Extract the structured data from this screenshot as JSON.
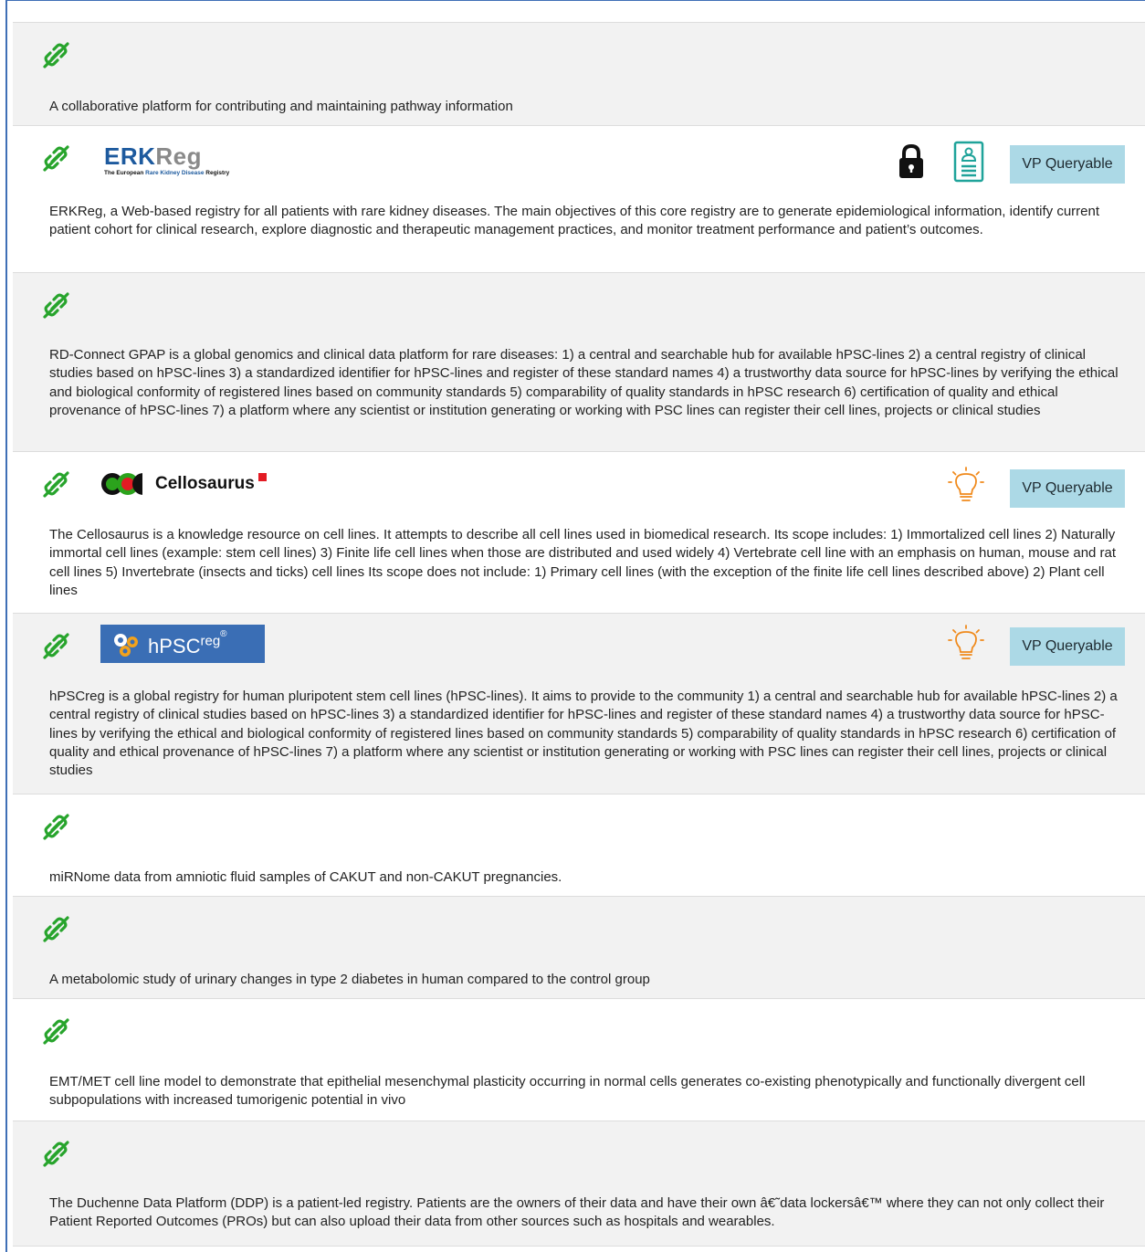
{
  "colors": {
    "link_icon": "#27a42c",
    "badge_bg": "#acd9e6",
    "frame": "#3f6fb6",
    "lightbulb": "#f08a1c",
    "row_shaded": "#f2f2f2"
  },
  "entries": [
    {
      "description": "A collaborative platform for contributing and maintaining pathway information"
    },
    {
      "logo": {
        "main_part1": "ERK",
        "main_part2": "Reg",
        "sub_pre": "The European ",
        "sub_hl": "Rare Kidney Disease",
        "sub_post": " Registry"
      },
      "icons": [
        "lock-icon",
        "document-icon"
      ],
      "badge": "VP Queryable",
      "description": "ERKReg, a Web-based registry for all patients with rare kidney diseases. The main objectives of this core registry are to generate epidemiological information, identify current patient cohort for clinical research, explore diagnostic and therapeutic management practices, and monitor treatment performance and patient’s outcomes."
    },
    {
      "description": "RD-Connect GPAP is a global genomics and clinical data platform for rare diseases: 1) a central and searchable hub for available hPSC-lines 2) a central registry of clinical studies based on hPSC-lines 3) a standardized identifier for hPSC-lines and register of these standard names 4) a trustworthy data source for hPSC-lines by verifying the ethical and biological conformity of registered lines based on community standards 5) comparability of quality standards in hPSC research 6) certification of quality and ethical provenance of hPSC-lines 7) a platform where any scientist or institution generating or working with PSC lines can register their cell lines, projects or clinical studies"
    },
    {
      "logo": {
        "text": "Cellosaurus"
      },
      "icons": [
        "lightbulb-icon"
      ],
      "badge": "VP Queryable",
      "description": "The Cellosaurus is a knowledge resource on cell lines. It attempts to describe all cell lines used in biomedical research. Its scope includes: 1) Immortalized cell lines 2) Naturally immortal cell lines (example: stem cell lines) 3) Finite life cell lines when those are distributed and used widely 4) Vertebrate cell line with an emphasis on human, mouse and rat cell lines 5) Invertebrate (insects and ticks) cell lines Its scope does not include: 1) Primary cell lines (with the exception of the finite life cell lines described above) 2) Plant cell lines"
    },
    {
      "logo": {
        "text": "hPSC",
        "sup": "reg",
        "mark": "®"
      },
      "icons": [
        "lightbulb-icon"
      ],
      "badge": "VP Queryable",
      "description": "hPSCreg is a global registry for human pluripotent stem cell lines (hPSC-lines). It aims to provide to the community 1) a central and searchable hub for available hPSC-lines 2) a central registry of clinical studies based on hPSC-lines 3) a standardized identifier for hPSC-lines and register of these standard names 4) a trustworthy data source for hPSC-lines by verifying the ethical and biological conformity of registered lines based on community standards 5) comparability of quality standards in hPSC research 6) certification of quality and ethical provenance of hPSC-lines 7) a platform where any scientist or institution generating or working with PSC lines can register their cell lines, projects or clinical studies"
    },
    {
      "description": "miRNome data from amniotic fluid samples of CAKUT and non-CAKUT pregnancies."
    },
    {
      "description": "A metabolomic study of urinary changes in type 2 diabetes in human compared to the control group"
    },
    {
      "description": "EMT/MET cell line model to demonstrate that epithelial mesenchymal plasticity occurring in normal cells generates co-existing phenotypically and functionally divergent cell subpopulations with increased tumorigenic potential in vivo"
    },
    {
      "description": "The Duchenne Data Platform (DDP) is a patient-led registry. Patients are the owners of their data and have their own â€˜data lockersâ€™ where they can not only collect their Patient Reported Outcomes (PROs) but can also upload their data from other sources such as hospitals and wearables."
    }
  ]
}
